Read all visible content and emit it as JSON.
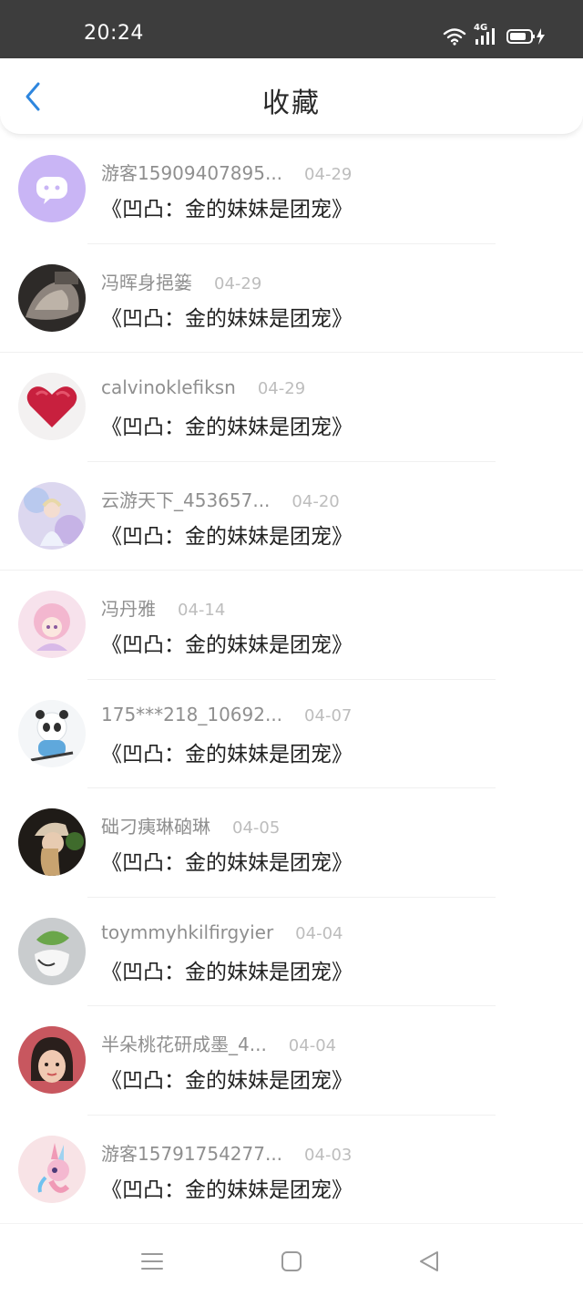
{
  "status_bar": {
    "time": "20:24",
    "network": "4G"
  },
  "header": {
    "title": "收藏"
  },
  "favorites": [
    {
      "username": "游客15909407895...",
      "date": "04-29",
      "book": "《凹凸：金的妹妹是团宠》"
    },
    {
      "username": "冯晖身挹篓",
      "date": "04-29",
      "book": "《凹凸：金的妹妹是团宠》"
    },
    {
      "username": "calvinoklefiksn",
      "date": "04-29",
      "book": "《凹凸：金的妹妹是团宠》"
    },
    {
      "username": "云游天下_453657...",
      "date": "04-20",
      "book": "《凹凸：金的妹妹是团宠》"
    },
    {
      "username": "冯丹雅",
      "date": "04-14",
      "book": "《凹凸：金的妹妹是团宠》"
    },
    {
      "username": "175***218_10692...",
      "date": "04-07",
      "book": "《凹凸：金的妹妹是团宠》"
    },
    {
      "username": "础刁痍琳硇琳",
      "date": "04-05",
      "book": "《凹凸：金的妹妹是团宠》"
    },
    {
      "username": "toymmyhkilfirgyier",
      "date": "04-04",
      "book": "《凹凸：金的妹妹是团宠》"
    },
    {
      "username": "半朵桃花研成墨_4...",
      "date": "04-04",
      "book": "《凹凸：金的妹妹是团宠》"
    },
    {
      "username": "游客15791754277...",
      "date": "04-03",
      "book": "《凹凸：金的妹妹是团宠》"
    }
  ],
  "colors": {
    "accent": "#2e86de",
    "status_bar": "#3d3d3d",
    "username": "#8f8f8f",
    "date": "#bdbdbd"
  },
  "icons": {
    "back": "chevron-left-icon",
    "wifi": "wifi-icon",
    "signal": "signal-icon",
    "battery": "battery-charging-icon",
    "menu": "menu-icon",
    "home": "home-square-icon",
    "nav_back": "triangle-back-icon"
  }
}
